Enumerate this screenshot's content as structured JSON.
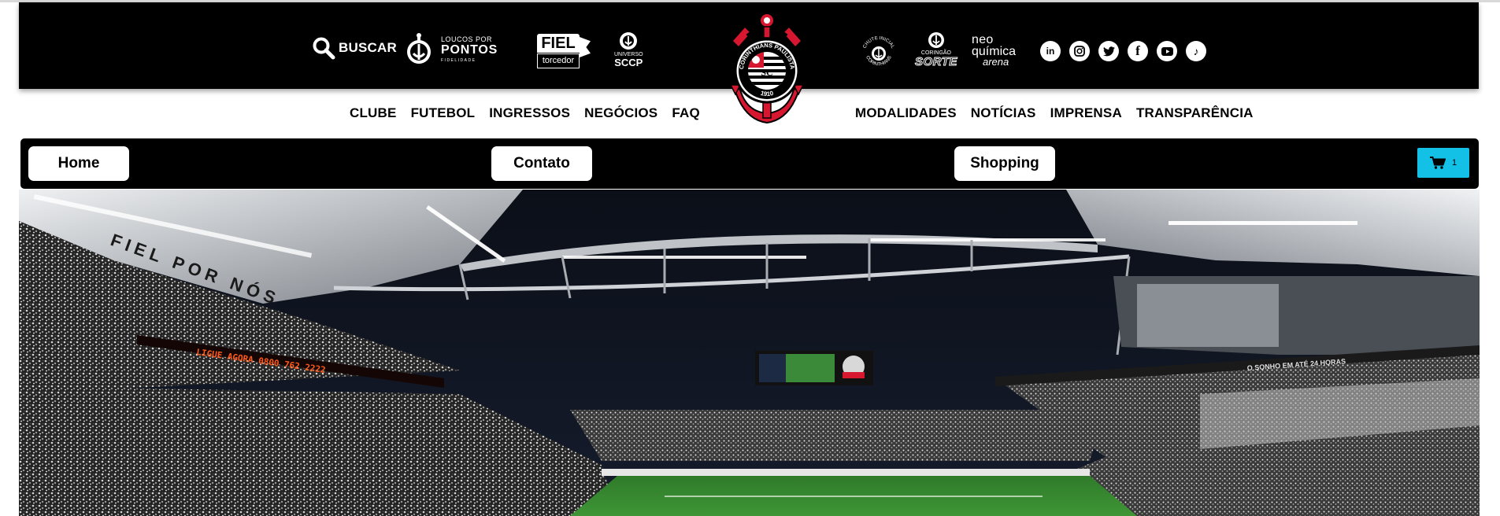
{
  "header": {
    "search_label": "BUSCAR",
    "loucos": {
      "line1": "LOUCOS POR",
      "line2": "PONTOS",
      "line3": "FIDELIDADE"
    },
    "fiel": {
      "top": "FIEL",
      "bottom": "torcedor"
    },
    "universo": {
      "line1": "UNIVERSO",
      "line2": "SCCP"
    },
    "chute": {
      "text": "CHUTE INICIAL CORINTHIANS"
    },
    "sorte": {
      "line1": "CORINGÃO",
      "line2": "SORTE"
    },
    "arena": {
      "line1": "neo",
      "line2": "química",
      "line3": "arena"
    },
    "crest": {
      "name": "CORINTHIANS PAULISTA",
      "year": "1910",
      "letters": "SC"
    },
    "social": [
      {
        "name": "linkedin",
        "glyph": "in"
      },
      {
        "name": "instagram",
        "glyph": ""
      },
      {
        "name": "twitter",
        "glyph": ""
      },
      {
        "name": "facebook",
        "glyph": "f"
      },
      {
        "name": "youtube",
        "glyph": ""
      },
      {
        "name": "tiktok",
        "glyph": "♪"
      }
    ]
  },
  "nav": {
    "left": [
      "CLUBE",
      "FUTEBOL",
      "INGRESSOS",
      "NEGÓCIOS",
      "FAQ"
    ],
    "right": [
      "MODALIDADES",
      "NOTÍCIAS",
      "IMPRENSA",
      "TRANSPARÊNCIA"
    ]
  },
  "buttons": {
    "home": "Home",
    "contato": "Contato",
    "shopping": "Shopping"
  },
  "cart": {
    "count": "1",
    "color": "#13c1e6"
  },
  "hero": {
    "stadium_banner": "FIEL POR NÓS",
    "led_board": "LIGUE AGORA 0800 762 2222",
    "led_board_right": "O SONHO EM ATÉ 24 HORAS"
  },
  "colors": {
    "brand_red": "#d7172f",
    "header_bg": "#000000",
    "accent_cyan": "#13c1e6"
  }
}
